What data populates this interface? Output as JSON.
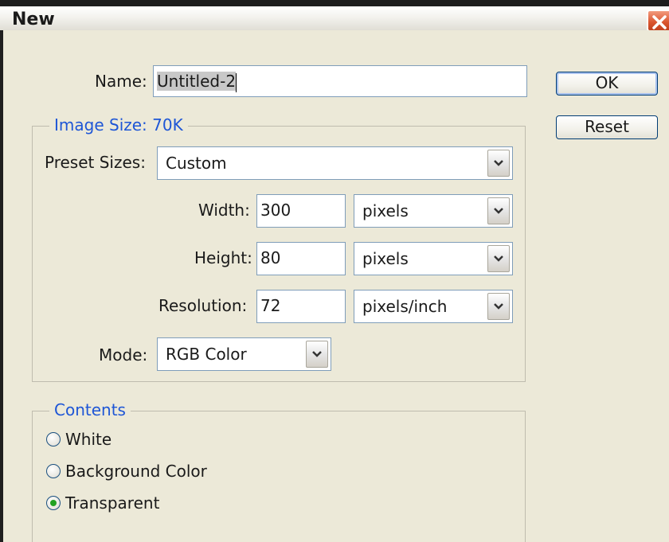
{
  "window": {
    "title": "New"
  },
  "name_field": {
    "label": "Name:",
    "value": "Untitled-2"
  },
  "buttons": {
    "ok": "OK",
    "reset": "Reset"
  },
  "image_size": {
    "legend": "Image Size: 70K",
    "preset_label": "Preset Sizes:",
    "preset_value": "Custom",
    "width_label": "Width:",
    "width_value": "300",
    "width_unit": "pixels",
    "height_label": "Height:",
    "height_value": "80",
    "height_unit": "pixels",
    "resolution_label": "Resolution:",
    "resolution_value": "72",
    "resolution_unit": "pixels/inch",
    "mode_label": "Mode:",
    "mode_value": "RGB Color"
  },
  "contents": {
    "legend": "Contents",
    "options": [
      {
        "label": "White",
        "checked": false
      },
      {
        "label": "Background Color",
        "checked": false
      },
      {
        "label": "Transparent",
        "checked": true
      }
    ]
  },
  "colors": {
    "legend_blue": "#1e56d6",
    "dialog_bg": "#ece9d8",
    "close_red": "#d9542e",
    "radio_checked": "#21a121"
  },
  "icons": {
    "close": "close-icon",
    "dropdown": "chevron-down-icon"
  }
}
